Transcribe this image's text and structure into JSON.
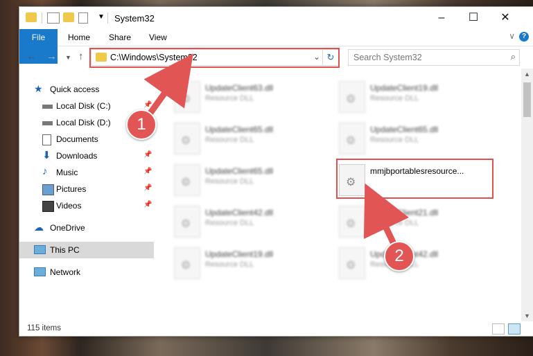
{
  "window": {
    "title": "System32"
  },
  "ribbon": {
    "tabs": [
      "File",
      "Home",
      "Share",
      "View"
    ],
    "help": "?"
  },
  "address": {
    "path": "C:\\Windows\\System32"
  },
  "search": {
    "placeholder": "Search System32"
  },
  "nav": {
    "quick_access": "Quick access",
    "items": [
      "Local Disk (C:)",
      "Local Disk (D:)",
      "Documents",
      "Downloads",
      "Music",
      "Pictures",
      "Videos"
    ],
    "onedrive": "OneDrive",
    "this_pc": "This PC",
    "network": "Network"
  },
  "files": [
    {
      "name": "UpdateClient63.dll",
      "desc": "Resource DLL"
    },
    {
      "name": "UpdateClient19.dll",
      "desc": "Resource DLL"
    },
    {
      "name": "UpdateClient65.dll",
      "desc": "Resource DLL"
    },
    {
      "name": "UpdateClient65.dll",
      "desc": "Resource DLL"
    },
    {
      "name": "UpdateClient65.dll",
      "desc": "Resource DLL"
    },
    {
      "name": "mmjbportablesresource...",
      "desc": ""
    },
    {
      "name": "UpdateClient42.dll",
      "desc": "Resource DLL"
    },
    {
      "name": "UpdateClient21.dll",
      "desc": "Resource DLL"
    },
    {
      "name": "UpdateClient19.dll",
      "desc": "Resource DLL"
    },
    {
      "name": "UpdateClient42.dll",
      "desc": "Resource DLL"
    }
  ],
  "status": {
    "count": "115 items"
  },
  "annotations": {
    "step1": "1",
    "step2": "2",
    "color": "#e25555"
  }
}
